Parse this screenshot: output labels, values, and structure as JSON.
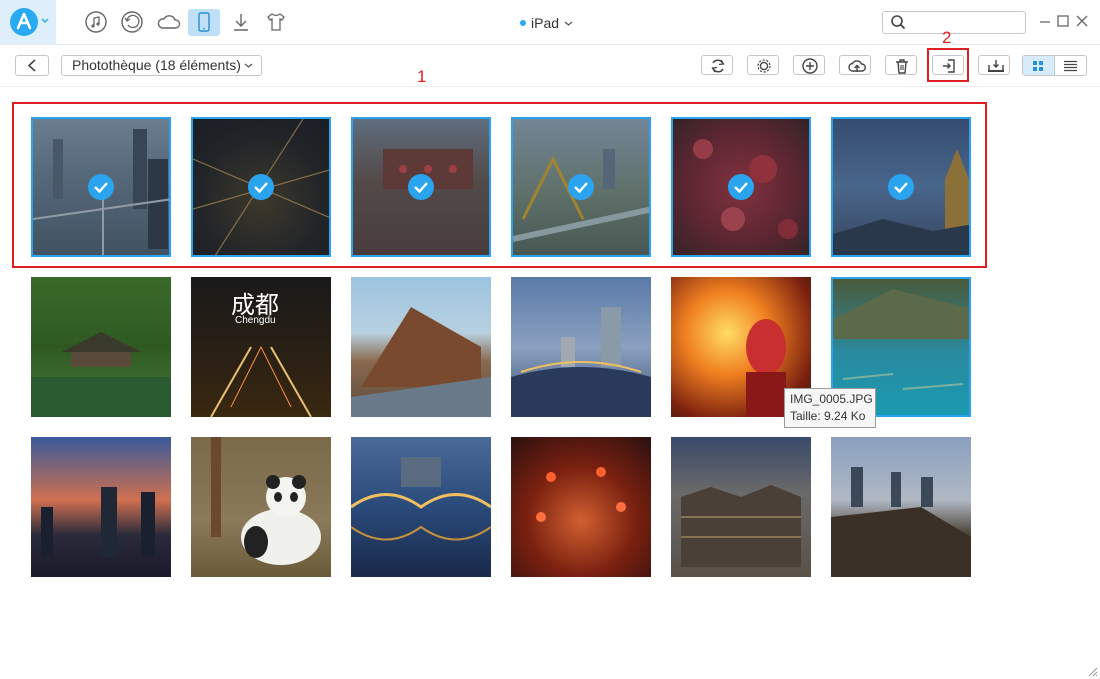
{
  "app": {
    "device_name": "iPad",
    "album_label": "Photothèque (18 éléments)",
    "search_placeholder": ""
  },
  "top_nav": [
    {
      "icon": "music-icon"
    },
    {
      "icon": "history-icon"
    },
    {
      "icon": "cloud-icon"
    },
    {
      "icon": "device-icon",
      "active": true
    },
    {
      "icon": "download-icon"
    },
    {
      "icon": "tshirt-icon"
    }
  ],
  "toolbar": {
    "buttons": [
      "refresh-icon",
      "settings-icon",
      "add-icon",
      "upload-cloud-icon",
      "trash-icon",
      "export-to-pc-icon",
      "export-to-device-icon"
    ]
  },
  "annotations": {
    "label_1": "1",
    "label_2": "2"
  },
  "tooltip": {
    "filename": "IMG_0005.JPG",
    "size": "Taille: 9.24 Ko"
  },
  "photos": [
    {
      "selected": true
    },
    {
      "selected": true
    },
    {
      "selected": true
    },
    {
      "selected": true
    },
    {
      "selected": true
    },
    {
      "selected": true
    },
    {
      "selected": false,
      "overlay_text_cn": "成都",
      "overlay_text": "Chengdu"
    },
    {
      "selected": false
    },
    {
      "selected": false
    },
    {
      "selected": false
    },
    {
      "selected": false
    },
    {
      "selected": false,
      "hovered": true
    },
    {
      "selected": false
    },
    {
      "selected": false
    },
    {
      "selected": false
    },
    {
      "selected": false
    },
    {
      "selected": false
    },
    {
      "selected": false
    }
  ],
  "colors": {
    "accent": "#2aa4ee",
    "annotation": "#e02020"
  }
}
